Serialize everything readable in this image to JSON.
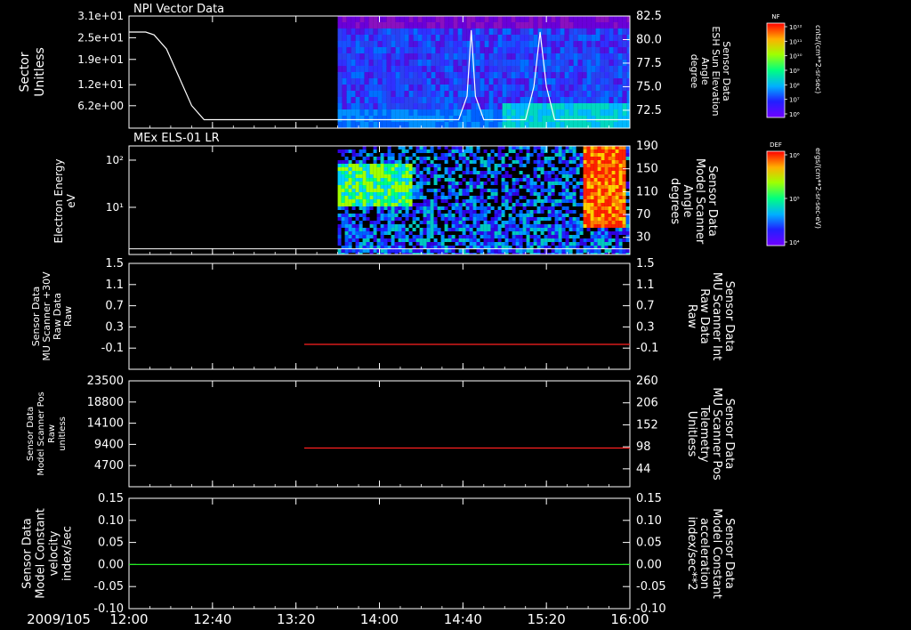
{
  "colors": {
    "background": "#000000",
    "text": "#ffffff",
    "red": "#ff2020",
    "green": "#22ee22"
  },
  "time_axis": {
    "date_label": "2009/105",
    "ticks": [
      "12:00",
      "12:40",
      "13:20",
      "14:00",
      "14:40",
      "15:20",
      "16:00"
    ],
    "tick_minutes": [
      0,
      40,
      80,
      120,
      160,
      200,
      240
    ]
  },
  "chart_data": [
    {
      "type": "heatmap",
      "title": "NPI Vector Data",
      "ylabel": [
        "Sector",
        "Unitless"
      ],
      "yticks": [
        "3.1e+01",
        "2.5e+01",
        "1.9e+01",
        "1.2e+01",
        "6.2e+00"
      ],
      "ytick_values": [
        31,
        25,
        19,
        12,
        6.2
      ],
      "ylim": [
        0,
        31
      ],
      "data_start_time": "13:40",
      "overlay_line": {
        "name": "ESH Sun Elevation Angle",
        "right_label": [
          "Sensor Data",
          "ESH Sun Elevation",
          "Angle",
          "degree"
        ],
        "right_ticks": [
          "82.5",
          "80.0",
          "77.5",
          "75.0",
          "72.5"
        ],
        "right_tick_values": [
          82.5,
          80.0,
          77.5,
          75.0,
          72.5
        ],
        "right_lim": [
          70.6,
          82.5
        ],
        "x_minutes": [
          0,
          8,
          12,
          18,
          24,
          30,
          36,
          40,
          60,
          100,
          158,
          162,
          164,
          166,
          170,
          190,
          194,
          197,
          200,
          204,
          240
        ],
        "values": [
          80.8,
          80.8,
          80.5,
          79.0,
          76.0,
          73.0,
          71.5,
          71.5,
          71.5,
          71.5,
          71.5,
          74.0,
          81.0,
          74.0,
          71.5,
          71.5,
          75.0,
          80.8,
          75.0,
          71.5,
          71.5
        ]
      },
      "colorbar": {
        "label": "NF",
        "units": "cnts/(cm**2-sr-sec)",
        "ticks": [
          "10¹²",
          "10¹¹",
          "10¹⁰",
          "10⁹",
          "10⁸",
          "10⁷",
          "10⁶"
        ]
      }
    },
    {
      "type": "heatmap",
      "title": "MEx ELS-01 LR",
      "ylabel": [
        "Electron Energy",
        "eV"
      ],
      "yticks": [
        "10²",
        "10¹"
      ],
      "ytick_values": [
        100,
        10
      ],
      "ylim_log": [
        1,
        200
      ],
      "data_start_time": "13:40",
      "overlay_line": {
        "name": "Model Scanner Angle",
        "right_label": [
          "Sensor Data",
          "Model Scanner",
          "Angle",
          "degrees"
        ],
        "right_ticks": [
          "190",
          "150",
          "110",
          "70",
          "30"
        ],
        "right_tick_values": [
          190,
          150,
          110,
          70,
          30
        ],
        "right_lim": [
          0,
          190
        ],
        "x_minutes": [
          0,
          240
        ],
        "values": [
          10,
          10
        ]
      },
      "colorbar": {
        "label": "DEF",
        "units": "ergs/(cm**2-sr-sec-eV)",
        "ticks": [
          "10⁶",
          "10⁵",
          "10⁴"
        ]
      }
    },
    {
      "type": "line",
      "left_label": [
        "Sensor Data",
        "MU Scanner +30V",
        "Raw Data",
        "Raw"
      ],
      "left_ticks": [
        "1.5",
        "1.1",
        "0.7",
        "0.3",
        "-0.1"
      ],
      "left_tick_values": [
        1.5,
        1.1,
        0.7,
        0.3,
        -0.1
      ],
      "right_label": [
        "Sensor Data",
        "MU Scanner Int",
        "Raw Data",
        "Raw"
      ],
      "right_ticks": [
        "1.5",
        "1.1",
        "0.7",
        "0.3",
        "-0.1"
      ],
      "right_tick_values": [
        1.5,
        1.1,
        0.7,
        0.3,
        -0.1
      ],
      "ylim": [
        -0.5,
        1.5
      ],
      "series": [
        {
          "name": "MU Scanner Int",
          "color": "#ff2020",
          "x_minutes": [
            84,
            240
          ],
          "values": [
            -0.03,
            -0.03
          ]
        }
      ]
    },
    {
      "type": "line",
      "left_label": [
        "Sensor Data",
        "Model Scanner Pos",
        "Raw",
        "unitless"
      ],
      "left_ticks": [
        "23500",
        "18800",
        "14100",
        "9400",
        "4700"
      ],
      "left_tick_values": [
        23500,
        18800,
        14100,
        9400,
        4700
      ],
      "right_label": [
        "Sensor Data",
        "MU Scanner Pos",
        "Telemetry",
        "Unitless"
      ],
      "right_ticks": [
        "260",
        "206",
        "152",
        "98",
        "44"
      ],
      "right_tick_values": [
        260,
        206,
        152,
        98,
        44
      ],
      "ylim": [
        0,
        23500
      ],
      "right_lim": [
        0,
        260
      ],
      "series": [
        {
          "name": "MU Scanner Pos Telemetry",
          "color": "#ff2020",
          "x_minutes": [
            84,
            240
          ],
          "values_right": [
            95,
            95
          ]
        }
      ]
    },
    {
      "type": "line",
      "left_label": [
        "Sensor Data",
        "Model Constant",
        "velocity",
        "index/sec"
      ],
      "left_ticks": [
        "0.15",
        "0.10",
        "0.05",
        "0.00",
        "-0.05",
        "-0.10"
      ],
      "left_tick_values": [
        0.15,
        0.1,
        0.05,
        0.0,
        -0.05,
        -0.1
      ],
      "right_label": [
        "Sensor Data",
        "Model Constant",
        "acceleration",
        "index/sec**2"
      ],
      "right_ticks": [
        "0.15",
        "0.10",
        "0.05",
        "0.00",
        "-0.05",
        "-0.10"
      ],
      "right_tick_values": [
        0.15,
        0.1,
        0.05,
        0.0,
        -0.05,
        -0.1
      ],
      "ylim": [
        -0.1,
        0.15
      ],
      "series": [
        {
          "name": "Model Constant velocity",
          "color": "#22ee22",
          "x_minutes": [
            0,
            240
          ],
          "values": [
            0.0,
            0.0
          ]
        }
      ]
    }
  ]
}
